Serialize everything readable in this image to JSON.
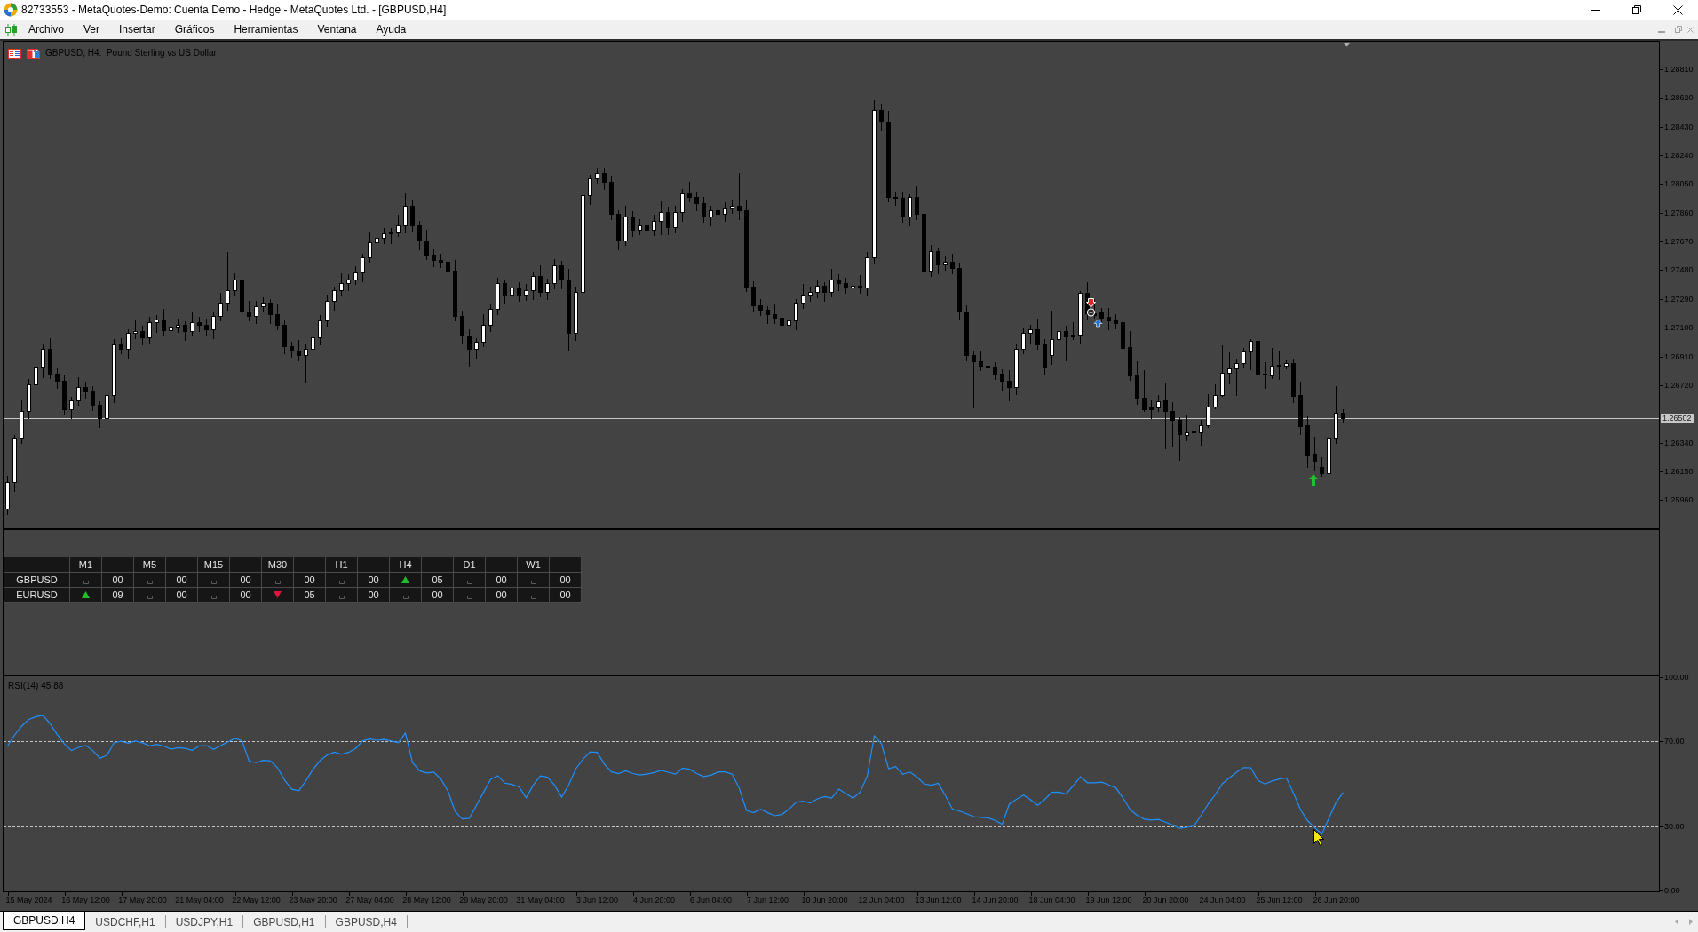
{
  "window": {
    "title": "82733553 - MetaQuotes-Demo: Cuenta Demo - Hedge - MetaQuotes Ltd. - [GBPUSD,H4]"
  },
  "menu": [
    "Archivo",
    "Ver",
    "Insertar",
    "Gráficos",
    "Herramientas",
    "Ventana",
    "Ayuda"
  ],
  "chart": {
    "chart_data": [
      {
        "type": "candlestick",
        "title": "GBPUSD, H4:  Pound Sterling vs US Dollar",
        "ylim": [
          1.25774,
          1.28992
        ],
        "yticks": [
          {
            "value": 1.2881,
            "label": "1.28810"
          },
          {
            "value": 1.2862,
            "label": "1.28620"
          },
          {
            "value": 1.2843,
            "label": "1.28430"
          },
          {
            "value": 1.2824,
            "label": "1.28240"
          },
          {
            "value": 1.2805,
            "label": "1.28050"
          },
          {
            "value": 1.2786,
            "label": "1.27860"
          },
          {
            "value": 1.2767,
            "label": "1.27670"
          },
          {
            "value": 1.2748,
            "label": "1.27480"
          },
          {
            "value": 1.2729,
            "label": "1.27290"
          },
          {
            "value": 1.271,
            "label": "1.27100"
          },
          {
            "value": 1.2691,
            "label": "1.26910"
          },
          {
            "value": 1.2672,
            "label": "1.26720"
          },
          {
            "value": 1.2634,
            "label": "1.26340"
          },
          {
            "value": 1.2615,
            "label": "1.26150"
          },
          {
            "value": 1.2596,
            "label": "1.25960"
          }
        ],
        "ohlc": [
          [
            1.25903,
            1.26122,
            1.25868,
            1.26082
          ],
          [
            1.26082,
            1.26393,
            1.26022,
            1.26368
          ],
          [
            1.26368,
            1.26617,
            1.26338,
            1.26547
          ],
          [
            1.26547,
            1.26761,
            1.26502,
            1.26726
          ],
          [
            1.26726,
            1.26874,
            1.26691,
            1.26834
          ],
          [
            1.26834,
            1.26988,
            1.26774,
            1.26963
          ],
          [
            1.26963,
            1.27033,
            1.26768,
            1.26798
          ],
          [
            1.26798,
            1.26833,
            1.26703,
            1.26748
          ],
          [
            1.26748,
            1.26788,
            1.26527,
            1.26562
          ],
          [
            1.26562,
            1.26644,
            1.26502,
            1.26619
          ],
          [
            1.26619,
            1.26775,
            1.26589,
            1.26705
          ],
          [
            1.26705,
            1.2674,
            1.26631,
            1.26676
          ],
          [
            1.26676,
            1.26716,
            1.26555,
            1.2659
          ],
          [
            1.2659,
            1.26615,
            1.26444,
            1.26504
          ],
          [
            1.26504,
            1.26725,
            1.26474,
            1.26655
          ],
          [
            1.26655,
            1.27026,
            1.2661,
            1.26991
          ],
          [
            1.26991,
            1.27031,
            1.26928,
            1.26963
          ],
          [
            1.26963,
            1.27088,
            1.26903,
            1.27063
          ],
          [
            1.27063,
            1.27147,
            1.27033,
            1.27077
          ],
          [
            1.27077,
            1.27112,
            1.26989,
            1.27034
          ],
          [
            1.27034,
            1.27174,
            1.26999,
            1.27134
          ],
          [
            1.27134,
            1.27181,
            1.27074,
            1.27156
          ],
          [
            1.27156,
            1.27226,
            1.27054,
            1.27084
          ],
          [
            1.27084,
            1.27141,
            1.27039,
            1.27106
          ],
          [
            1.27106,
            1.2716,
            1.27071,
            1.2712
          ],
          [
            1.2712,
            1.27145,
            1.27017,
            1.27077
          ],
          [
            1.27077,
            1.27204,
            1.27047,
            1.27134
          ],
          [
            1.27134,
            1.27169,
            1.27075,
            1.2712
          ],
          [
            1.2712,
            1.2716,
            1.27056,
            1.27091
          ],
          [
            1.27091,
            1.27202,
            1.27031,
            1.27177
          ],
          [
            1.27177,
            1.27333,
            1.27147,
            1.27263
          ],
          [
            1.27263,
            1.276,
            1.27218,
            1.27349
          ],
          [
            1.27349,
            1.27461,
            1.27314,
            1.27421
          ],
          [
            1.27421,
            1.27446,
            1.27146,
            1.27206
          ],
          [
            1.27206,
            1.27276,
            1.27147,
            1.27177
          ],
          [
            1.27177,
            1.27277,
            1.27132,
            1.27242
          ],
          [
            1.27242,
            1.27303,
            1.27207,
            1.27263
          ],
          [
            1.27263,
            1.27288,
            1.27132,
            1.27192
          ],
          [
            1.27192,
            1.27262,
            1.2709,
            1.2712
          ],
          [
            1.2712,
            1.27155,
            1.26932,
            1.26977
          ],
          [
            1.26977,
            1.2701,
            1.26905,
            1.26948
          ],
          [
            1.26948,
            1.27017,
            1.26885,
            1.2692
          ],
          [
            1.2692,
            1.26988,
            1.2674,
            1.26963
          ],
          [
            1.26963,
            1.27104,
            1.26933,
            1.27034
          ],
          [
            1.27034,
            1.27184,
            1.26989,
            1.27149
          ],
          [
            1.27149,
            1.27318,
            1.27114,
            1.27278
          ],
          [
            1.27278,
            1.27374,
            1.27218,
            1.27349
          ],
          [
            1.27349,
            1.27462,
            1.27319,
            1.27392
          ],
          [
            1.27392,
            1.27456,
            1.27347,
            1.27421
          ],
          [
            1.27421,
            1.27504,
            1.27386,
            1.27464
          ],
          [
            1.27464,
            1.27589,
            1.27404,
            1.27564
          ],
          [
            1.27564,
            1.27734,
            1.27534,
            1.27664
          ],
          [
            1.27664,
            1.27728,
            1.27619,
            1.27693
          ],
          [
            1.27693,
            1.27761,
            1.27658,
            1.27721
          ],
          [
            1.27721,
            1.27761,
            1.27661,
            1.27736
          ],
          [
            1.27736,
            1.27849,
            1.27706,
            1.27779
          ],
          [
            1.27779,
            1.27994,
            1.27734,
            1.27908
          ],
          [
            1.27908,
            1.27948,
            1.27744,
            1.27779
          ],
          [
            1.27779,
            1.27804,
            1.27618,
            1.27678
          ],
          [
            1.27678,
            1.27748,
            1.27555,
            1.27585
          ],
          [
            1.27585,
            1.2762,
            1.27505,
            1.2755
          ],
          [
            1.2755,
            1.2759,
            1.275,
            1.27535
          ],
          [
            1.27535,
            1.2756,
            1.27418,
            1.27478
          ],
          [
            1.27478,
            1.27548,
            1.27147,
            1.27177
          ],
          [
            1.27177,
            1.27212,
            1.27003,
            1.27048
          ],
          [
            1.27048,
            1.27088,
            1.2684,
            1.26963
          ],
          [
            1.26963,
            1.2703,
            1.26903,
            1.27005
          ],
          [
            1.27005,
            1.2719,
            1.26975,
            1.2712
          ],
          [
            1.2712,
            1.27262,
            1.27075,
            1.27227
          ],
          [
            1.27227,
            1.27432,
            1.27192,
            1.27392
          ],
          [
            1.27392,
            1.27417,
            1.27261,
            1.27321
          ],
          [
            1.27321,
            1.27433,
            1.27291,
            1.27363
          ],
          [
            1.27363,
            1.27398,
            1.27276,
            1.27321
          ],
          [
            1.27321,
            1.27389,
            1.27286,
            1.27349
          ],
          [
            1.27349,
            1.27467,
            1.27289,
            1.27442
          ],
          [
            1.27442,
            1.27512,
            1.27305,
            1.27335
          ],
          [
            1.27335,
            1.27427,
            1.2729,
            1.27392
          ],
          [
            1.27392,
            1.27554,
            1.27357,
            1.27514
          ],
          [
            1.27514,
            1.27539,
            1.27361,
            1.27421
          ],
          [
            1.27421,
            1.27491,
            1.2695,
            1.27063
          ],
          [
            1.27063,
            1.2737,
            1.27018,
            1.27335
          ],
          [
            1.27335,
            1.28019,
            1.273,
            1.27979
          ],
          [
            1.27979,
            1.28112,
            1.27919,
            1.28087
          ],
          [
            1.28087,
            1.2816,
            1.28057,
            1.28122
          ],
          [
            1.28122,
            1.28157,
            1.2802,
            1.28065
          ],
          [
            1.28065,
            1.28105,
            1.27815,
            1.2785
          ],
          [
            1.2785,
            1.27875,
            1.27618,
            1.27678
          ],
          [
            1.27678,
            1.27906,
            1.27648,
            1.27836
          ],
          [
            1.27836,
            1.27871,
            1.27705,
            1.2775
          ],
          [
            1.2775,
            1.27819,
            1.27715,
            1.27779
          ],
          [
            1.27779,
            1.27804,
            1.2769,
            1.2775
          ],
          [
            1.2775,
            1.27845,
            1.27712,
            1.27808
          ],
          [
            1.27808,
            1.27935,
            1.2772,
            1.27865
          ],
          [
            1.27865,
            1.279,
            1.27719,
            1.27764
          ],
          [
            1.27764,
            1.27905,
            1.27729,
            1.27865
          ],
          [
            1.27865,
            1.28019,
            1.27805,
            1.27994
          ],
          [
            1.27994,
            1.28064,
            1.27935,
            1.27965
          ],
          [
            1.27965,
            1.28,
            1.27877,
            1.27922
          ],
          [
            1.27922,
            1.27962,
            1.27801,
            1.27836
          ],
          [
            1.27836,
            1.27904,
            1.27776,
            1.27879
          ],
          [
            1.27879,
            1.27949,
            1.2782,
            1.2785
          ],
          [
            1.2785,
            1.27928,
            1.27805,
            1.27893
          ],
          [
            1.27893,
            1.27948,
            1.27858,
            1.27908
          ],
          [
            1.27908,
            1.28122,
            1.27819,
            1.27879
          ],
          [
            1.27879,
            1.27949,
            1.27341,
            1.27371
          ],
          [
            1.27371,
            1.27406,
            1.27204,
            1.27249
          ],
          [
            1.27249,
            1.27289,
            1.27185,
            1.2722
          ],
          [
            1.2722,
            1.27245,
            1.27132,
            1.27192
          ],
          [
            1.27192,
            1.27262,
            1.27133,
            1.27163
          ],
          [
            1.27163,
            1.27198,
            1.2693,
            1.2712
          ],
          [
            1.2712,
            1.27189,
            1.27085,
            1.27149
          ],
          [
            1.27149,
            1.27288,
            1.27089,
            1.27263
          ],
          [
            1.27263,
            1.27391,
            1.27233,
            1.27321
          ],
          [
            1.27321,
            1.2737,
            1.27276,
            1.27335
          ],
          [
            1.27335,
            1.27418,
            1.273,
            1.27378
          ],
          [
            1.27378,
            1.27403,
            1.27275,
            1.27335
          ],
          [
            1.27335,
            1.27491,
            1.27305,
            1.27421
          ],
          [
            1.27421,
            1.27456,
            1.27347,
            1.27392
          ],
          [
            1.27392,
            1.27432,
            1.27328,
            1.27363
          ],
          [
            1.27363,
            1.27403,
            1.27303,
            1.27378
          ],
          [
            1.27378,
            1.27448,
            1.27333,
            1.27363
          ],
          [
            1.27363,
            1.27599,
            1.27318,
            1.27564
          ],
          [
            1.27564,
            1.28602,
            1.27529,
            1.28538
          ],
          [
            1.28538,
            1.2858,
            1.28406,
            1.28466
          ],
          [
            1.28466,
            1.28536,
            1.27935,
            1.27965
          ],
          [
            1.27965,
            1.28,
            1.27913,
            1.27958
          ],
          [
            1.27958,
            1.27998,
            1.27801,
            1.27836
          ],
          [
            1.27836,
            1.2799,
            1.27776,
            1.27965
          ],
          [
            1.27965,
            1.28035,
            1.2782,
            1.2785
          ],
          [
            1.2785,
            1.27885,
            1.27433,
            1.27478
          ],
          [
            1.27478,
            1.27647,
            1.27443,
            1.27607
          ],
          [
            1.27607,
            1.27632,
            1.27461,
            1.27521
          ],
          [
            1.27521,
            1.27575,
            1.2748,
            1.27535
          ],
          [
            1.27535,
            1.27591,
            1.27462,
            1.27492
          ],
          [
            1.27492,
            1.27527,
            1.27161,
            1.27206
          ],
          [
            1.27206,
            1.27246,
            1.26885,
            1.2692
          ],
          [
            1.2692,
            1.26945,
            1.2657,
            1.26877
          ],
          [
            1.26877,
            1.26947,
            1.26818,
            1.26848
          ],
          [
            1.26848,
            1.26883,
            1.26789,
            1.26834
          ],
          [
            1.26834,
            1.26874,
            1.26763,
            1.26798
          ],
          [
            1.26798,
            1.26823,
            1.26688,
            1.26748
          ],
          [
            1.26748,
            1.26818,
            1.2662,
            1.26705
          ],
          [
            1.26705,
            1.26998,
            1.2666,
            1.26963
          ],
          [
            1.26963,
            1.27103,
            1.26928,
            1.27063
          ],
          [
            1.27063,
            1.27116,
            1.27003,
            1.27091
          ],
          [
            1.27091,
            1.27161,
            1.26961,
            1.26991
          ],
          [
            1.26991,
            1.27026,
            1.26789,
            1.26834
          ],
          [
            1.26919,
            1.27213,
            1.26861,
            1.27027
          ],
          [
            1.27025,
            1.27099,
            1.26978,
            1.2708
          ],
          [
            1.27076,
            1.27115,
            1.26884,
            1.27041
          ],
          [
            1.27041,
            1.27135,
            1.27027,
            1.27056
          ],
          [
            1.27056,
            1.2734,
            1.26998,
            1.27331
          ],
          [
            1.27331,
            1.27399,
            1.27154,
            1.27197
          ],
          [
            1.27197,
            1.27291,
            1.27164,
            1.27184
          ],
          [
            1.27209,
            1.27233,
            1.27135,
            1.27164
          ],
          [
            1.2717,
            1.27229,
            1.27092,
            1.2715
          ],
          [
            1.27154,
            1.2719,
            1.27096,
            1.27131
          ],
          [
            1.27139,
            1.27154,
            1.26955,
            1.26968
          ],
          [
            1.26972,
            1.27076,
            1.26753,
            1.26782
          ],
          [
            1.26782,
            1.26876,
            1.26596,
            1.26635
          ],
          [
            1.26635,
            1.26821,
            1.26547,
            1.26563
          ],
          [
            1.26571,
            1.26622,
            1.26504,
            1.26563
          ],
          [
            1.26571,
            1.26655,
            1.26551,
            1.26616
          ],
          [
            1.2662,
            1.26733,
            1.26302,
            1.26547
          ],
          [
            1.26547,
            1.26606,
            1.26312,
            1.26489
          ],
          [
            1.26489,
            1.26508,
            1.26224,
            1.26395
          ],
          [
            1.26391,
            1.26518,
            1.26355,
            1.26406
          ],
          [
            1.26408,
            1.26459,
            1.26293,
            1.26412
          ],
          [
            1.26406,
            1.26489,
            1.26328,
            1.26453
          ],
          [
            1.26453,
            1.26661,
            1.26446,
            1.26577
          ],
          [
            1.26577,
            1.26724,
            1.26567,
            1.26653
          ],
          [
            1.26653,
            1.26984,
            1.26649,
            1.26802
          ],
          [
            1.26802,
            1.26935,
            1.26733,
            1.26829
          ],
          [
            1.26829,
            1.26896,
            1.26655,
            1.26867
          ],
          [
            1.26867,
            1.26968,
            1.26837,
            1.26941
          ],
          [
            1.26941,
            1.27027,
            1.26825,
            1.27013
          ],
          [
            1.27013,
            1.27033,
            1.26753,
            1.26798
          ],
          [
            1.26798,
            1.2687,
            1.267,
            1.2679
          ],
          [
            1.26786,
            1.26964,
            1.26767,
            1.26847
          ],
          [
            1.26857,
            1.26943,
            1.26759,
            1.26849
          ],
          [
            1.26847,
            1.26882,
            1.26831,
            1.26865
          ],
          [
            1.26866,
            1.2689,
            1.2661,
            1.26651
          ],
          [
            1.26655,
            1.26743,
            1.26395,
            1.26449
          ],
          [
            1.26455,
            1.26512,
            1.26179,
            1.26258
          ],
          [
            1.26261,
            1.26381,
            1.26156,
            1.26214
          ],
          [
            1.26179,
            1.26244,
            1.2612,
            1.2614
          ],
          [
            1.2614,
            1.2637,
            1.26132,
            1.26365
          ],
          [
            1.26365,
            1.26712,
            1.2634,
            1.2654
          ],
          [
            1.2654,
            1.2656,
            1.2647,
            1.26502
          ],
          null,
          null,
          null,
          null,
          null,
          null,
          null,
          null,
          null,
          null,
          null,
          null,
          null,
          null,
          null,
          null,
          null,
          null,
          null,
          null,
          null,
          null,
          null,
          null,
          null,
          null,
          null,
          null,
          null,
          null,
          null,
          null,
          null,
          null,
          null,
          null,
          null,
          null,
          null,
          null,
          null,
          null,
          null,
          null
        ],
        "ref_lines": [
          {
            "axis": "y",
            "value": 1.26502,
            "label": "1.26502",
            "color": "#c8c8c8",
            "line_style": "solid"
          }
        ]
      },
      {
        "type": "line",
        "title": "RSI(14) 45.88",
        "ylim": [
          0,
          100
        ],
        "yticks": [
          {
            "value": 100,
            "label": "100.00"
          },
          {
            "value": 70,
            "label": "70.00"
          },
          {
            "value": 30,
            "label": "30.00"
          },
          {
            "value": 0,
            "label": "0.00"
          }
        ],
        "categories": [
          null,
          null,
          null,
          "15 May 2024",
          null,
          null,
          null,
          null,
          null,
          null,
          null,
          "16 May 12:00",
          null,
          null,
          null,
          null,
          null,
          null,
          null,
          "17 May 20:00",
          null,
          null,
          null,
          null,
          null,
          null,
          null,
          "21 May 04:00",
          null,
          null,
          null,
          null,
          null,
          null,
          null,
          "22 May 12:00",
          null,
          null,
          null,
          null,
          null,
          null,
          null,
          "23 May 20:00",
          null,
          null,
          null,
          null,
          null,
          null,
          null,
          "27 May 04:00",
          null,
          null,
          null,
          null,
          null,
          null,
          null,
          "28 May 12:00",
          null,
          null,
          null,
          null,
          null,
          null,
          null,
          "29 May 20:00",
          null,
          null,
          null,
          null,
          null,
          null,
          null,
          "31 May 04:00",
          null,
          null,
          null,
          null,
          null,
          null,
          null,
          "3 Jun 12:00",
          null,
          null,
          null,
          null,
          null,
          null,
          null,
          "4 Jun 20:00",
          null,
          null,
          null,
          null,
          null,
          null,
          null,
          "6 Jun 04:00",
          null,
          null,
          null,
          null,
          null,
          null,
          null,
          "7 Jun 12:00",
          null,
          null,
          null,
          null,
          null,
          null,
          null,
          "10 Jun 20:00",
          null,
          null,
          null,
          null,
          null,
          null,
          null,
          "12 Jun 04:00",
          null,
          null,
          null,
          null,
          null,
          null,
          null,
          "13 Jun 12:00",
          null,
          null,
          null,
          null,
          null,
          null,
          null,
          "14 Jun 20:00",
          null,
          null,
          null,
          null,
          null,
          null,
          null,
          "18 Jun 04:00",
          null,
          null,
          null,
          null,
          null,
          null,
          null,
          "19 Jun 12:00",
          null,
          null,
          null,
          null,
          null,
          null,
          null,
          "20 Jun 20:00",
          null,
          null,
          null,
          null,
          null,
          null,
          null,
          "24 Jun 04:00",
          null,
          null,
          null,
          null,
          null,
          null,
          null,
          "25 Jun 12:00",
          null,
          null,
          null,
          null,
          null,
          null,
          null,
          "26 Jun 20:00",
          null,
          null,
          null,
          null,
          null,
          null,
          null,
          null,
          null,
          null,
          null,
          null,
          null,
          null,
          null,
          null,
          null,
          null,
          null,
          null,
          null,
          null,
          null,
          null,
          null,
          null,
          null,
          null,
          null,
          null,
          null,
          null,
          null,
          null,
          null,
          null,
          null,
          null,
          null,
          null,
          null,
          null,
          null,
          null,
          null
        ],
        "values": [
          67.7,
          72.9,
          77.1,
          80.2,
          81.5,
          82.1,
          78.2,
          73.1,
          68.7,
          65.6,
          67.1,
          68.0,
          65.6,
          62.0,
          63.4,
          69.3,
          69.9,
          69.0,
          70.1,
          69.2,
          67.8,
          68.5,
          67.7,
          66.2,
          66.9,
          66.6,
          65.7,
          67.8,
          67.9,
          66.1,
          67.9,
          69.6,
          71.3,
          70.2,
          60.6,
          59.9,
          61.0,
          60.7,
          57.5,
          51.7,
          47.4,
          46.7,
          51.4,
          56.8,
          60.9,
          63.5,
          64.8,
          63.8,
          64.7,
          66.6,
          70.2,
          71.0,
          70.4,
          70.8,
          70.1,
          69.3,
          73.8,
          59.9,
          56.1,
          55.1,
          55.5,
          52.2,
          46.5,
          37.0,
          33.5,
          33.8,
          39.9,
          46.0,
          52.1,
          53.8,
          50.3,
          49.7,
          48.6,
          43.4,
          49.4,
          53.7,
          53.1,
          49.3,
          43.7,
          49.6,
          57.1,
          61.5,
          64.9,
          64.7,
          59.2,
          55.6,
          54.8,
          56.1,
          54.8,
          54.1,
          54.5,
          55.3,
          56.3,
          55.4,
          54.5,
          57.3,
          56.8,
          54.8,
          53.4,
          54.0,
          55.6,
          55.6,
          54.5,
          47.8,
          37.5,
          36.4,
          38.1,
          36.4,
          35.0,
          35.6,
          38.1,
          41.3,
          41.8,
          41.0,
          42.9,
          44.0,
          43.3,
          47.5,
          45.4,
          43.2,
          46.1,
          53.5,
          72.5,
          68.8,
          57.1,
          58.1,
          54.5,
          55.5,
          53.2,
          50.0,
          49.3,
          50.2,
          44.5,
          38.1,
          37.2,
          35.9,
          34.6,
          34.2,
          34.0,
          32.8,
          31.0,
          40.4,
          42.7,
          44.7,
          42.5,
          39.9,
          42.7,
          46.0,
          46.1,
          45.2,
          49.1,
          53.3,
          50.5,
          50.5,
          50.8,
          49.5,
          48.1,
          43.4,
          37.9,
          35.2,
          33.4,
          33.0,
          33.3,
          32.0,
          30.6,
          29.1,
          29.6,
          30.2,
          35.2,
          40.5,
          45.0,
          50.0,
          52.8,
          55.4,
          57.6,
          57.5,
          51.6,
          49.9,
          51.3,
          52.2,
          52.8,
          45.6,
          37.8,
          32.6,
          29.4,
          26.5,
          33.9,
          41.3,
          45.9,
          null,
          null,
          null,
          null,
          null,
          null,
          null,
          null,
          null,
          null,
          null,
          null,
          null,
          null,
          null,
          null,
          null,
          null,
          null,
          null,
          null,
          null,
          null,
          null,
          null,
          null,
          null,
          null,
          null,
          null,
          null,
          null,
          null,
          null,
          null,
          null,
          null,
          null,
          null,
          null,
          null,
          null,
          null,
          null
        ],
        "color": "#1e90ff",
        "ref_lines": [
          {
            "axis": "y",
            "value": 70,
            "color": "#c8c8c8",
            "line_style": "dashed"
          },
          {
            "axis": "y",
            "value": 30,
            "color": "#c8c8c8",
            "line_style": "dashed"
          }
        ]
      }
    ],
    "signal_table": {
      "timeframes": [
        "M1",
        "M5",
        "M15",
        "M30",
        "H1",
        "H4",
        "D1",
        "W1"
      ],
      "rows": [
        {
          "symbol": "GBPUSD",
          "cells": [
            {
              "kind": "none",
              "count": "00"
            },
            {
              "kind": "none",
              "count": "00"
            },
            {
              "kind": "none",
              "count": "00"
            },
            {
              "kind": "none",
              "count": "00"
            },
            {
              "kind": "none",
              "count": "00"
            },
            {
              "kind": "up",
              "count": "05"
            },
            {
              "kind": "none",
              "count": "00"
            },
            {
              "kind": "none",
              "count": "00"
            }
          ]
        },
        {
          "symbol": "EURUSD",
          "cells": [
            {
              "kind": "up",
              "count": "09"
            },
            {
              "kind": "none",
              "count": "00"
            },
            {
              "kind": "none",
              "count": "00"
            },
            {
              "kind": "down",
              "count": "05"
            },
            {
              "kind": "none",
              "count": "00"
            },
            {
              "kind": "none",
              "count": "00"
            },
            {
              "kind": "none",
              "count": "00"
            },
            {
              "kind": "none",
              "count": "00"
            }
          ]
        }
      ]
    }
  },
  "tabs": [
    {
      "label": "GBPUSD,H4",
      "selected": true
    },
    {
      "label": "USDCHF,H1",
      "selected": false
    },
    {
      "label": "USDJPY,H1",
      "selected": false
    },
    {
      "label": "GBPUSD,H1",
      "selected": false
    },
    {
      "label": "GBPUSD,H4",
      "selected": false
    }
  ]
}
